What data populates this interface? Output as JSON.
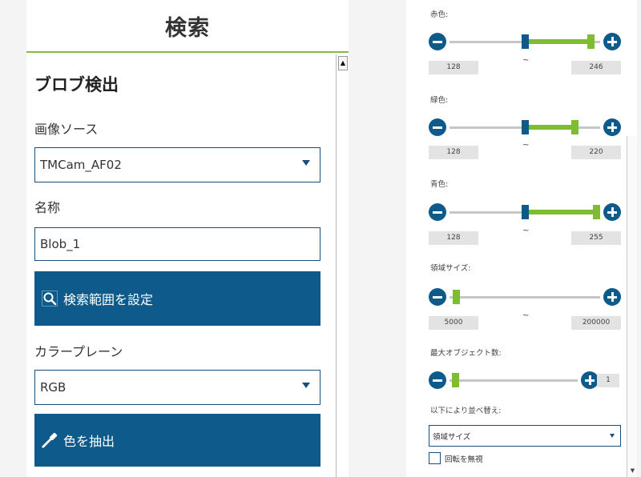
{
  "left": {
    "title": "検索",
    "section_title": "ブロブ検出",
    "image_source": {
      "label": "画像ソース",
      "value": "TMCam_AF02"
    },
    "name": {
      "label": "名称",
      "value": "Blob_1"
    },
    "search_range_button": "検索範囲を設定",
    "color_plane": {
      "label": "カラープレーン",
      "value": "RGB"
    },
    "extract_color_button": "色を抽出"
  },
  "right": {
    "sliders": [
      {
        "label": "赤色:",
        "min": "128",
        "max": "246",
        "low_fraction": 0.5,
        "high_fraction": 0.96
      },
      {
        "label": "緑色:",
        "min": "128",
        "max": "220",
        "low_fraction": 0.5,
        "high_fraction": 0.85
      },
      {
        "label": "青色:",
        "min": "128",
        "max": "255",
        "low_fraction": 0.5,
        "high_fraction": 1.0
      },
      {
        "label": "領域サイズ:",
        "min": "5000",
        "max": "200000",
        "low_fraction": 0.02,
        "high_fraction": 0.02
      }
    ],
    "max_objects": {
      "label": "最大オブジェクト数:",
      "value": "1",
      "fraction": 0.02
    },
    "sort": {
      "label": "以下により並べ替え:",
      "value": "領域サイズ"
    },
    "ignore_rotation": {
      "label": "回転を無視",
      "checked": false
    },
    "dash": "~"
  }
}
